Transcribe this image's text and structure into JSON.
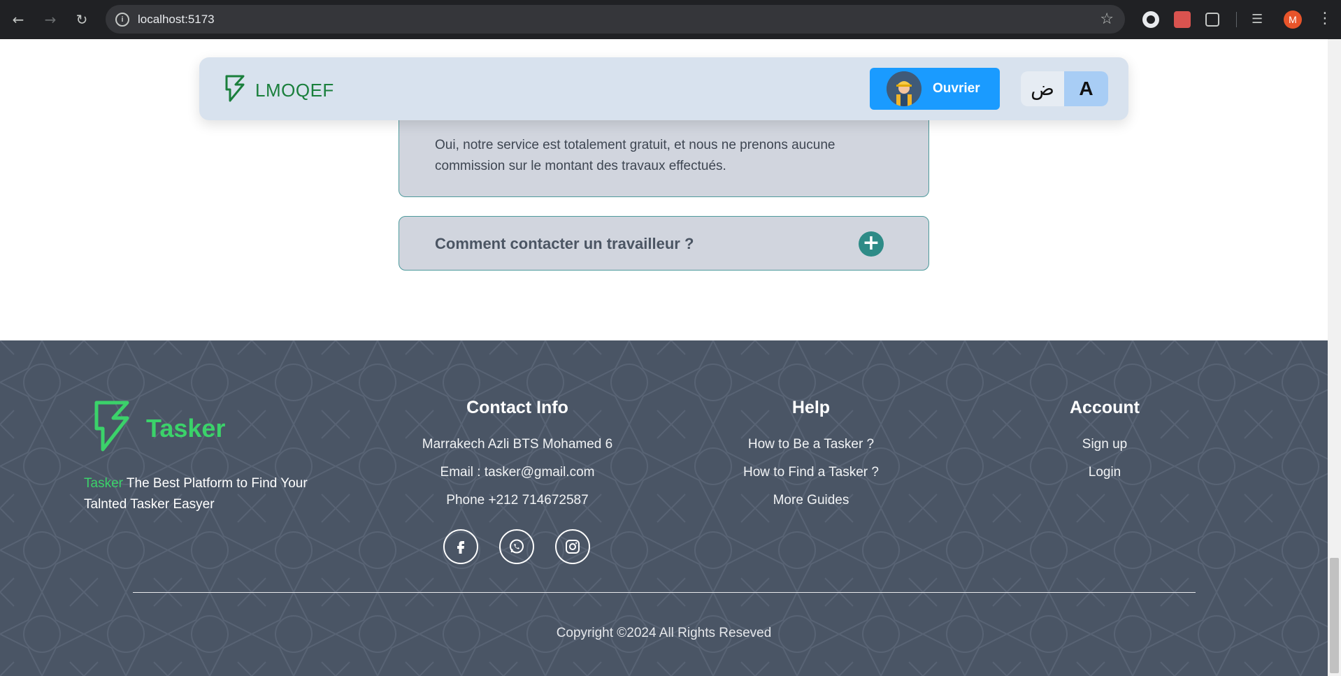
{
  "browser": {
    "url": "localhost:5173",
    "profile_initial": "M"
  },
  "navbar": {
    "brand": "LMOQEF",
    "role_label": "Ouvrier",
    "lang_ar": "ض",
    "lang_en": "A"
  },
  "faq": {
    "open_answer": "Oui, notre service est totalement gratuit, et nous ne prenons aucune commission sur le montant des travaux effectués.",
    "closed_question": "Comment contacter un travailleur ?",
    "plus_symbol": "+"
  },
  "footer": {
    "logo_text": "Tasker",
    "tagline_accent": "Tasker",
    "tagline_rest": " The Best Platform to Find Your Talnted Tasker Easyer",
    "contact": {
      "title": "Contact Info",
      "address": "Marrakech Azli BTS Mohamed 6",
      "email": "Email : tasker@gmail.com",
      "phone": "Phone +212 714672587"
    },
    "help": {
      "title": "Help",
      "links": [
        "How to Be a Tasker ?",
        "How to Find a Tasker ?",
        "More Guides"
      ]
    },
    "account": {
      "title": "Account",
      "links": [
        "Sign up",
        "Login"
      ]
    },
    "socials": [
      "facebook-icon",
      "whatsapp-icon",
      "instagram-icon"
    ],
    "copyright": "Copyright ©2024 All Rights Reseved"
  },
  "colors": {
    "accent_green": "#3bd26a",
    "role_blue": "#1a9bff",
    "footer_bg": "#4a5565",
    "faq_border": "#4e9a9c"
  }
}
